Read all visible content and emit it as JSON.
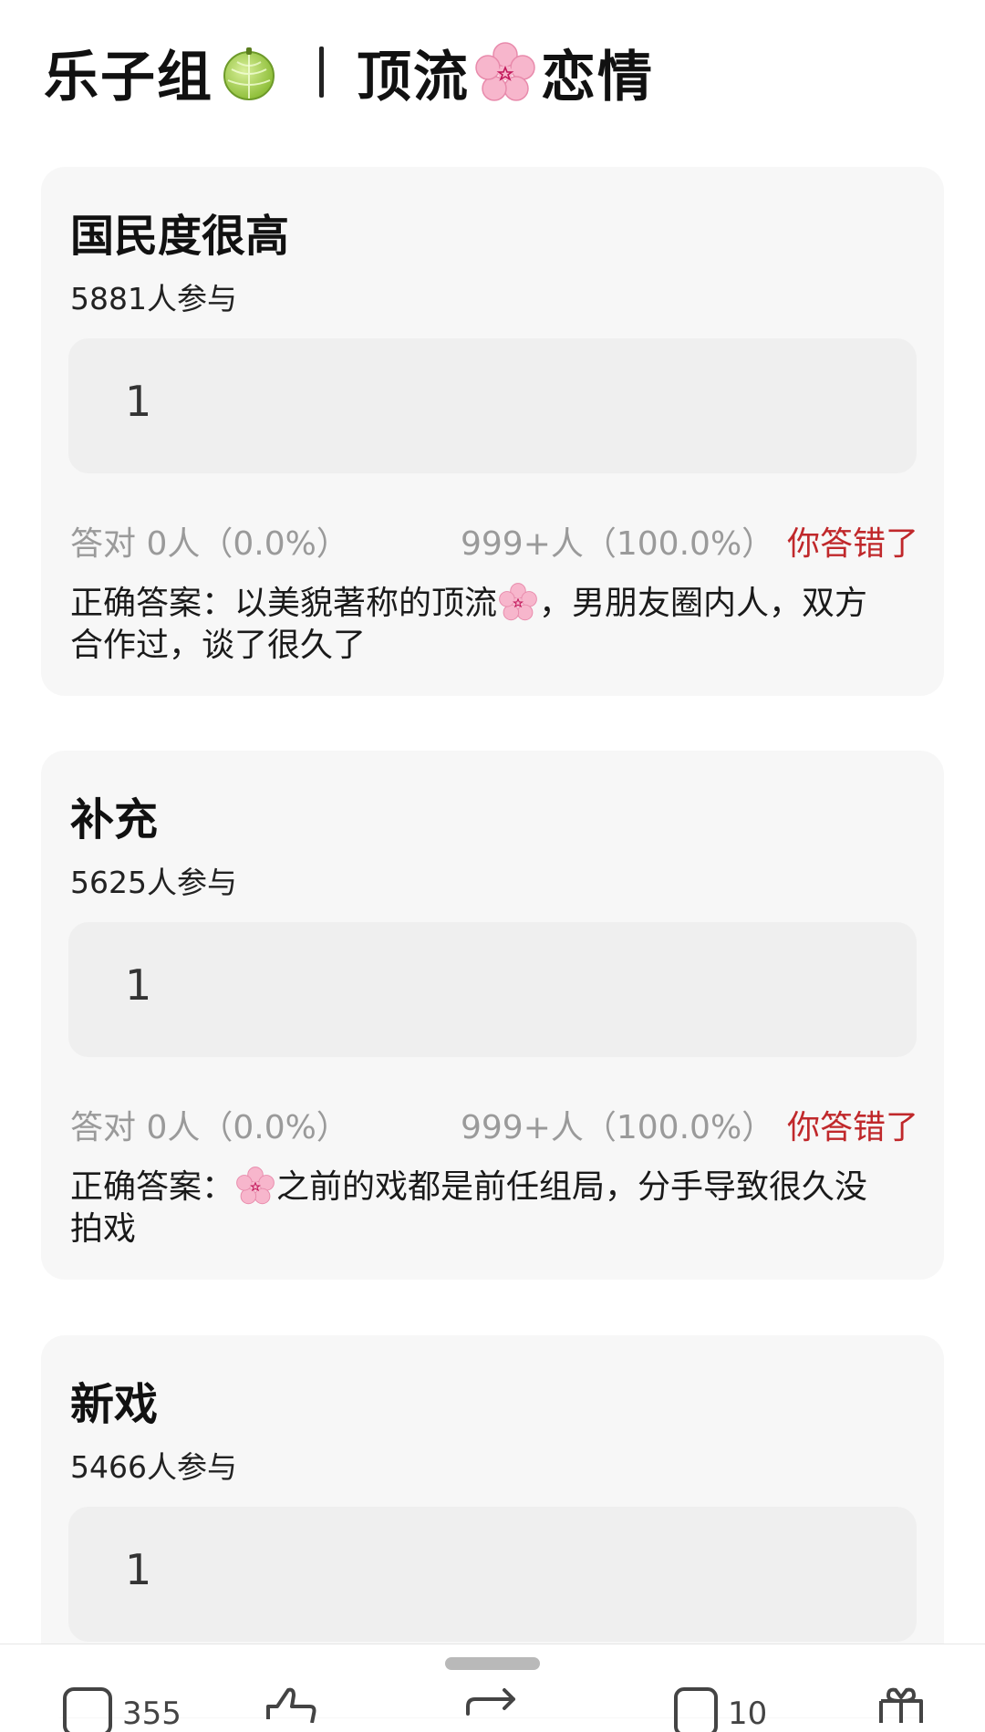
{
  "header": {
    "left_text": "乐子组",
    "left_emoji": "melon-icon",
    "right_text_1": "顶流",
    "right_emoji": "cherry-blossom-icon",
    "right_text_2": "恋情"
  },
  "cards": [
    {
      "title": "国民度很高",
      "participants": "5881人参与",
      "answer_value": "1",
      "correct_stat": "答对  0人（0.0%）",
      "wrong_stat": "999+人（100.0%）",
      "result_tag": "你答错了",
      "correct_answer_pre": "正确答案：以美貌著称的顶流",
      "correct_answer_post": "，男朋友圈内人，双方合作过，谈了很久了"
    },
    {
      "title": "补充",
      "participants": "5625人参与",
      "answer_value": "1",
      "correct_stat": "答对  0人（0.0%）",
      "wrong_stat": "999+人（100.0%）",
      "result_tag": "你答错了",
      "correct_answer_pre": "正确答案：",
      "correct_answer_post": "之前的戏都是前任组局，分手导致很久没拍戏"
    },
    {
      "title": "新戏",
      "participants": "5466人参与",
      "answer_value": "1"
    }
  ],
  "bottom_bar": {
    "comments_count": "355",
    "messages_count": "10"
  },
  "colors": {
    "card_bg": "#f7f7f7",
    "answer_box_bg": "#efefef",
    "wrong_red": "#c0282b",
    "muted_gray": "#9a9a9a"
  }
}
